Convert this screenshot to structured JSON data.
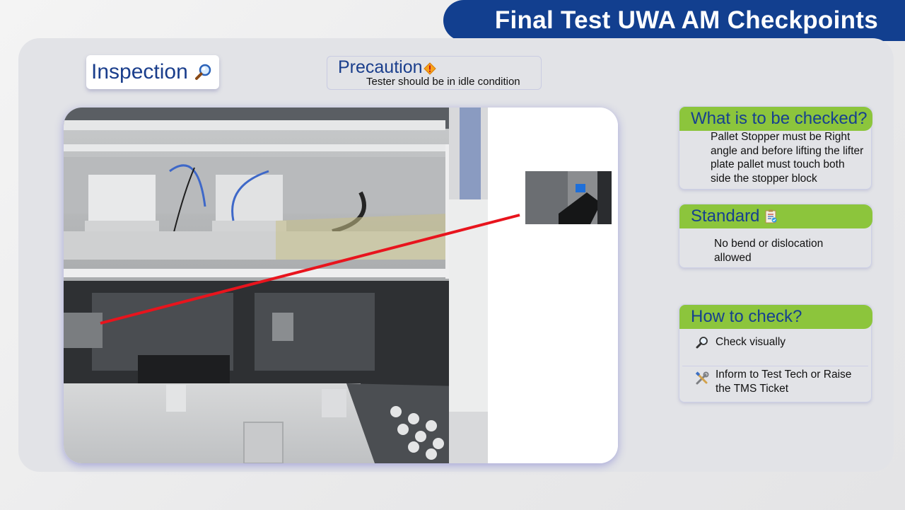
{
  "header": {
    "title": "Final Test UWA AM Checkpoints"
  },
  "inspection": {
    "label": "Inspection",
    "icon": "magnifier-icon"
  },
  "precaution": {
    "label": "Precaution",
    "icon": "warning-icon",
    "note": "Tester should be in idle condition"
  },
  "photo": {
    "main_image": "machine-station-photo",
    "inset_image": "stopper-closeup-photo",
    "pointer_color": "#e8141d"
  },
  "what_to_check": {
    "title": "What is to be checked?",
    "lines": [
      "Pallet Stopper must be Right",
      "angle and before lifting the lifter",
      "plate pallet must touch both",
      "side the stopper block"
    ]
  },
  "standard": {
    "title": "Standard",
    "icon": "checklist-icon",
    "lines": [
      "No bend or dislocation",
      "allowed"
    ]
  },
  "how_to_check": {
    "title": "How to check?",
    "items": [
      {
        "icon": "magnifier-icon",
        "lines": [
          "Check visually"
        ]
      },
      {
        "icon": "tools-icon",
        "lines": [
          "Inform to Test Tech or Raise",
          "the TMS Ticket"
        ]
      }
    ]
  },
  "colors": {
    "title_bar": "#123f8f",
    "heading_text": "#1a3e8c",
    "card_header": "#8cc53c",
    "panel": "#e2e3e7"
  }
}
